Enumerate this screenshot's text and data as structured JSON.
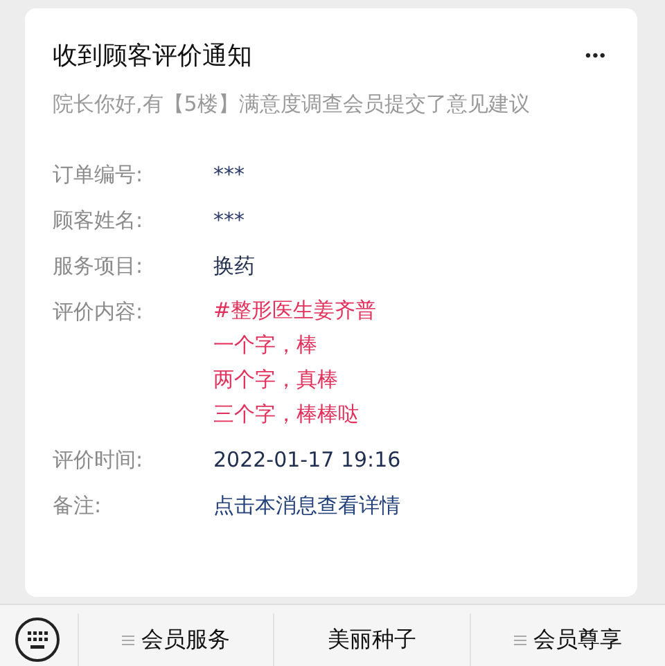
{
  "card": {
    "title": "收到顾客评价通知",
    "more": "•••",
    "summary": "院长你好,有【5楼】满意度调查会员提交了意见建议",
    "fields": [
      {
        "label": "订单编号:",
        "kind": "masked",
        "value": "***"
      },
      {
        "label": "顾客姓名:",
        "kind": "masked",
        "value": "***"
      },
      {
        "label": "服务项目:",
        "kind": "text",
        "value": "换药"
      },
      {
        "label": "评价内容:",
        "kind": "review",
        "lines": [
          "#整形医生姜齐普",
          "一个字，棒",
          "两个字，真棒",
          "三个字，棒棒哒"
        ]
      },
      {
        "label": "评价时间:",
        "kind": "text",
        "value": "2022-01-17 19:16"
      },
      {
        "label": "备注:",
        "kind": "link",
        "value": "点击本消息查看详情"
      }
    ]
  },
  "menu_bar": {
    "items": [
      {
        "label": "会员服务",
        "submenu": true
      },
      {
        "label": "美丽种子",
        "submenu": false
      },
      {
        "label": "会员尊享",
        "submenu": true
      }
    ]
  }
}
